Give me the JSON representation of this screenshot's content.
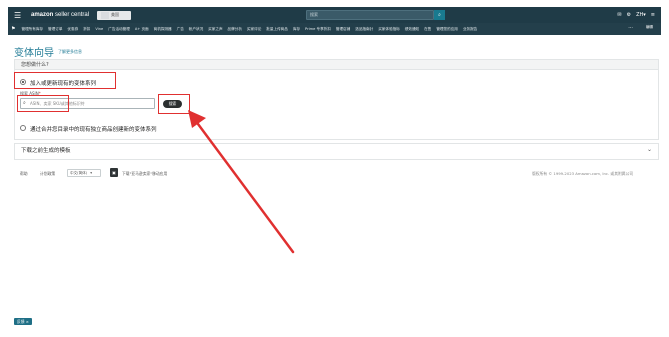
{
  "topbar": {
    "brand_prefix": "amazon",
    "brand_suffix": "seller central",
    "store_label": "",
    "store_region": "美国",
    "search_placeholder": "搜索",
    "search_icon": "search-icon",
    "lang": "ZH",
    "lang_caret": "▾",
    "icons": [
      "mail-icon",
      "gear-icon"
    ]
  },
  "nav": {
    "items": [
      "管理所有库存",
      "管理订单",
      "优惠券",
      "折扣",
      "Vine",
      "广告活动管理",
      "A+ 页面",
      "商机探测器",
      "广告",
      "帐户状况",
      "买家之声",
      "品牌分析",
      "买家评论",
      "批量上传商品",
      "库存",
      "Prime 专享折扣",
      "管理店铺",
      "选品指南针",
      "买家体验指标",
      "绩效通知",
      "在售",
      "管理您的应用",
      "业务报告"
    ],
    "more": "···",
    "edit": "编辑"
  },
  "page": {
    "title": "变体向导",
    "learn_more": "了解更多信息"
  },
  "card": {
    "header": "您想做什么?",
    "option1": "加入或更新现有的变体系列",
    "asin_label": "搜索 ASIN",
    "asin_required": "*",
    "asin_placeholder": "ASIN、卖家 SKU或其他标识符",
    "search_button": "搜索",
    "option2": "通过合并您目录中的现有独立商品创建新的变体系列"
  },
  "template": {
    "label": "下载之前生成的模板",
    "chevron": "⌄"
  },
  "footer": {
    "help": "帮助",
    "program_policy": "计划政策",
    "language": "中文(简体)",
    "language_caret": "▾",
    "app_promo": "下载\"亚马逊卖家\"移动应用",
    "copyright": "版权所有 © 1999-2023 Amazon.com, Inc. 或其附属公司"
  },
  "bottom_badge": "反馈 ×",
  "colors": {
    "topbar": "#1f3b47",
    "accent": "#1f7a95",
    "highlight": "#e03030"
  }
}
